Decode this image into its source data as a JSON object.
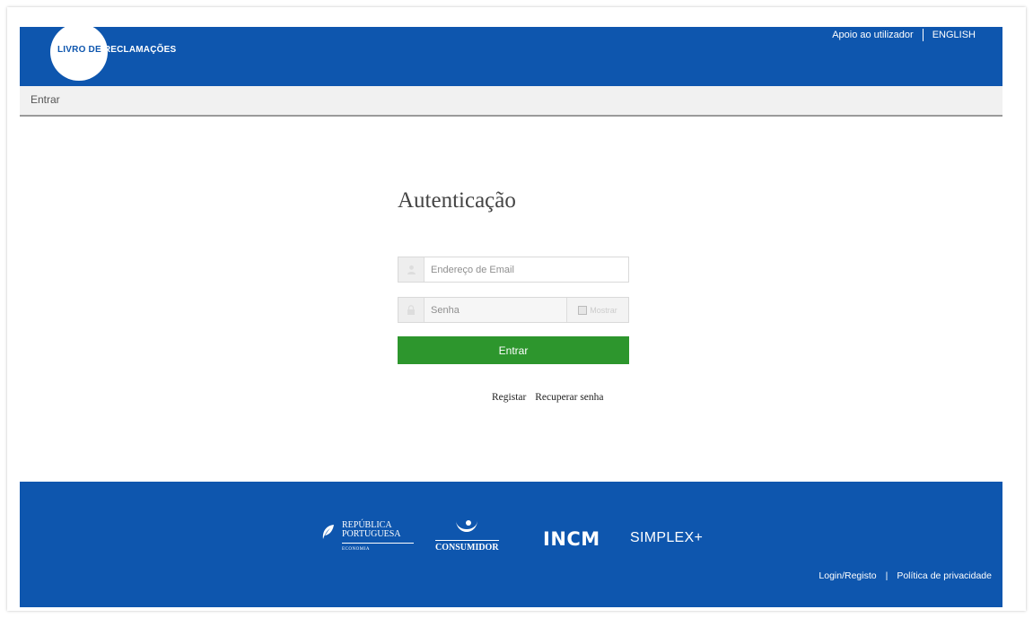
{
  "header": {
    "logo_part1": "LIVRO DE",
    "logo_part2": "RECLAMAÇÕES",
    "support_link": "Apoio ao utilizador",
    "language_link": "ENGLISH"
  },
  "breadcrumb": {
    "current": "Entrar"
  },
  "auth": {
    "title": "Autenticação",
    "email_placeholder": "Endereço de Email",
    "password_placeholder": "Senha",
    "show_password_label": "Mostrar",
    "submit_label": "Entrar",
    "register_link": "Registar",
    "recover_link": "Recuperar senha"
  },
  "footer": {
    "republica_line1": "REPÚBLICA",
    "republica_line2": "PORTUGUESA",
    "republica_sub": "ECONOMIA",
    "consumidor_label": "CONSUMIDOR",
    "incm_label": "INCM",
    "simplex_label": "SIMPLEX+",
    "login_link": "Login/Registo",
    "privacy_link": "Política de privacidade"
  },
  "colors": {
    "brand_blue": "#0e56ae",
    "submit_green": "#2d962d"
  }
}
